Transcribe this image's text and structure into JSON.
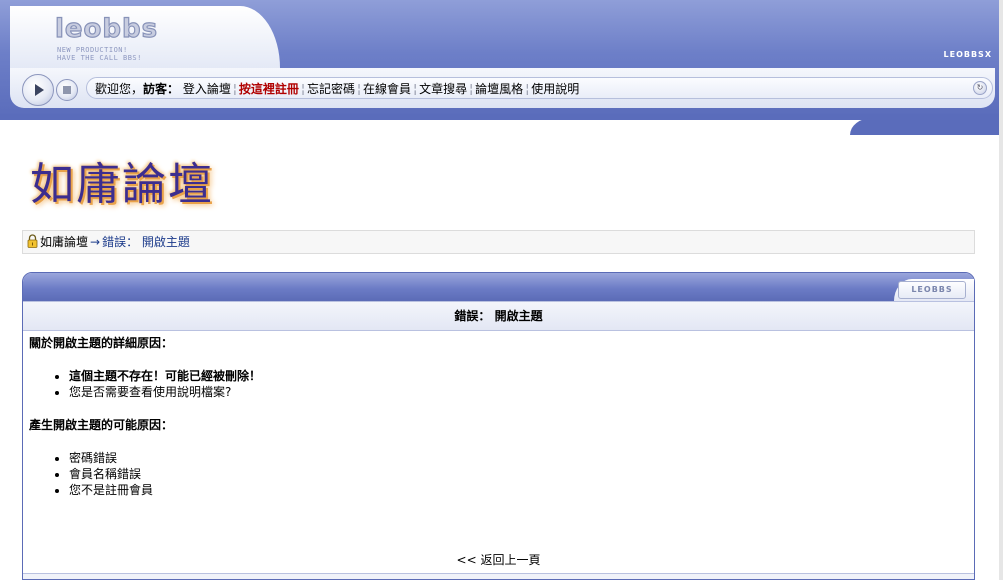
{
  "header": {
    "logo_text": "leobbs",
    "logo_sub_line1": "NEW PRODUCTION!",
    "logo_sub_line2": "HAVE THE CALL BBS!",
    "brand_right": "LEOBBSX",
    "nav": {
      "welcome": "歡迎您，",
      "guest": "訪客：",
      "links": [
        "登入論壇",
        "按這裡註冊",
        "忘記密碼",
        "在線會員",
        "文章搜尋",
        "論壇風格",
        "使用說明"
      ]
    }
  },
  "forum_title": "如庸論壇",
  "breadcrumb": {
    "home": "如庸論壇",
    "arrow": "→",
    "current": "錯誤： 開啟主題"
  },
  "panel": {
    "badge": "LEOBBS",
    "title": "錯誤： 開啟主題",
    "section1_heading": "關於開啟主題的詳細原因：",
    "section1_items": [
      "這個主題不存在！可能已經被刪除！",
      "您是否需要查看使用說明檔案?"
    ],
    "section2_heading": "產生開啟主題的可能原因：",
    "section2_items": [
      "密碼錯誤",
      "會員名稱錯誤",
      "您不是註冊會員"
    ],
    "back_link": "<< 返回上一頁"
  }
}
